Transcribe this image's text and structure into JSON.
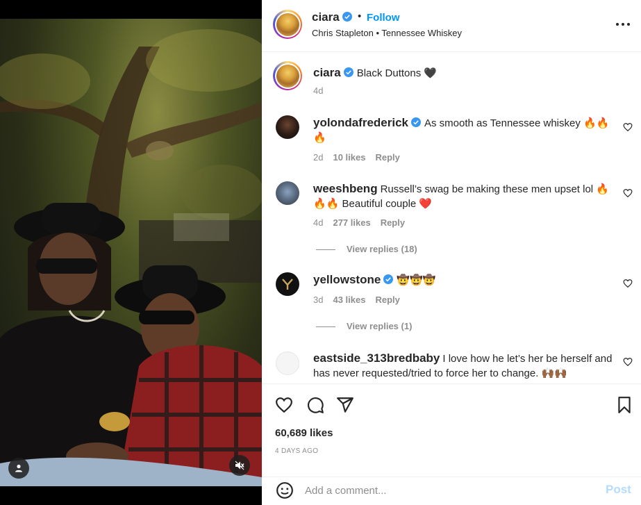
{
  "post": {
    "username": "ciara",
    "separator": "•",
    "follow_label": "Follow",
    "music": "Chris Stapleton • Tennessee Whiskey",
    "caption": {
      "username": "ciara",
      "text": "Black Duttons 🖤",
      "age": "4d"
    },
    "likes": "60,689 likes",
    "date": "4 DAYS AGO",
    "comment_placeholder": "Add a comment...",
    "post_label": "Post"
  },
  "comments": [
    {
      "username": "yolondafrederick",
      "verified": true,
      "text": "As smooth as Tennessee whiskey 🔥🔥🔥",
      "age": "2d",
      "likes": "10 likes",
      "reply": "Reply"
    },
    {
      "username": "weeshbeng",
      "verified": false,
      "text": "Russell’s swag be making these men upset lol 🔥🔥🔥 Beautiful couple ❤️",
      "age": "4d",
      "likes": "277 likes",
      "reply": "Reply",
      "view_replies": "View replies (18)"
    },
    {
      "username": "yellowstone",
      "verified": true,
      "text": "🤠🤠🤠",
      "age": "3d",
      "likes": "43 likes",
      "reply": "Reply",
      "view_replies": "View replies (1)"
    },
    {
      "username": "eastside_313bredbaby",
      "verified": false,
      "text": "I love how he let’s her be herself and has never requested/tried to force her to change. 🙌🏾🙌🏾"
    }
  ],
  "icons": {
    "more": "more-options-icon",
    "like": "heart-icon",
    "comment": "comment-icon",
    "share": "send-icon",
    "save": "bookmark-icon",
    "emoji": "emoji-icon",
    "tagged": "user-icon",
    "mute": "audio-muted-icon"
  },
  "colors": {
    "accent": "#0095f6",
    "verified": "#3897f0",
    "post_disabled": "#b3dbff",
    "meta": "#8e8e8e"
  }
}
